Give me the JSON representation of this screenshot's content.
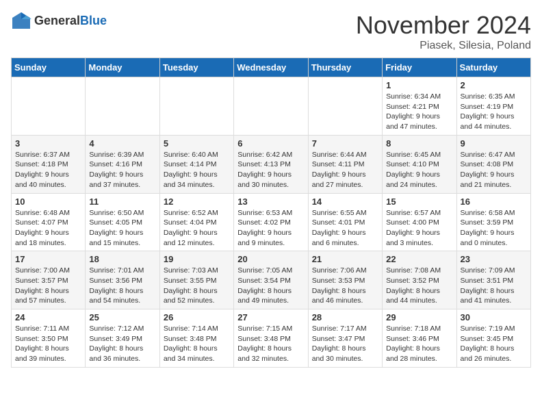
{
  "header": {
    "logo_general": "General",
    "logo_blue": "Blue",
    "month": "November 2024",
    "location": "Piasek, Silesia, Poland"
  },
  "days_of_week": [
    "Sunday",
    "Monday",
    "Tuesday",
    "Wednesday",
    "Thursday",
    "Friday",
    "Saturday"
  ],
  "weeks": [
    [
      {
        "day": "",
        "info": ""
      },
      {
        "day": "",
        "info": ""
      },
      {
        "day": "",
        "info": ""
      },
      {
        "day": "",
        "info": ""
      },
      {
        "day": "",
        "info": ""
      },
      {
        "day": "1",
        "info": "Sunrise: 6:34 AM\nSunset: 4:21 PM\nDaylight: 9 hours\nand 47 minutes."
      },
      {
        "day": "2",
        "info": "Sunrise: 6:35 AM\nSunset: 4:19 PM\nDaylight: 9 hours\nand 44 minutes."
      }
    ],
    [
      {
        "day": "3",
        "info": "Sunrise: 6:37 AM\nSunset: 4:18 PM\nDaylight: 9 hours\nand 40 minutes."
      },
      {
        "day": "4",
        "info": "Sunrise: 6:39 AM\nSunset: 4:16 PM\nDaylight: 9 hours\nand 37 minutes."
      },
      {
        "day": "5",
        "info": "Sunrise: 6:40 AM\nSunset: 4:14 PM\nDaylight: 9 hours\nand 34 minutes."
      },
      {
        "day": "6",
        "info": "Sunrise: 6:42 AM\nSunset: 4:13 PM\nDaylight: 9 hours\nand 30 minutes."
      },
      {
        "day": "7",
        "info": "Sunrise: 6:44 AM\nSunset: 4:11 PM\nDaylight: 9 hours\nand 27 minutes."
      },
      {
        "day": "8",
        "info": "Sunrise: 6:45 AM\nSunset: 4:10 PM\nDaylight: 9 hours\nand 24 minutes."
      },
      {
        "day": "9",
        "info": "Sunrise: 6:47 AM\nSunset: 4:08 PM\nDaylight: 9 hours\nand 21 minutes."
      }
    ],
    [
      {
        "day": "10",
        "info": "Sunrise: 6:48 AM\nSunset: 4:07 PM\nDaylight: 9 hours\nand 18 minutes."
      },
      {
        "day": "11",
        "info": "Sunrise: 6:50 AM\nSunset: 4:05 PM\nDaylight: 9 hours\nand 15 minutes."
      },
      {
        "day": "12",
        "info": "Sunrise: 6:52 AM\nSunset: 4:04 PM\nDaylight: 9 hours\nand 12 minutes."
      },
      {
        "day": "13",
        "info": "Sunrise: 6:53 AM\nSunset: 4:02 PM\nDaylight: 9 hours\nand 9 minutes."
      },
      {
        "day": "14",
        "info": "Sunrise: 6:55 AM\nSunset: 4:01 PM\nDaylight: 9 hours\nand 6 minutes."
      },
      {
        "day": "15",
        "info": "Sunrise: 6:57 AM\nSunset: 4:00 PM\nDaylight: 9 hours\nand 3 minutes."
      },
      {
        "day": "16",
        "info": "Sunrise: 6:58 AM\nSunset: 3:59 PM\nDaylight: 9 hours\nand 0 minutes."
      }
    ],
    [
      {
        "day": "17",
        "info": "Sunrise: 7:00 AM\nSunset: 3:57 PM\nDaylight: 8 hours\nand 57 minutes."
      },
      {
        "day": "18",
        "info": "Sunrise: 7:01 AM\nSunset: 3:56 PM\nDaylight: 8 hours\nand 54 minutes."
      },
      {
        "day": "19",
        "info": "Sunrise: 7:03 AM\nSunset: 3:55 PM\nDaylight: 8 hours\nand 52 minutes."
      },
      {
        "day": "20",
        "info": "Sunrise: 7:05 AM\nSunset: 3:54 PM\nDaylight: 8 hours\nand 49 minutes."
      },
      {
        "day": "21",
        "info": "Sunrise: 7:06 AM\nSunset: 3:53 PM\nDaylight: 8 hours\nand 46 minutes."
      },
      {
        "day": "22",
        "info": "Sunrise: 7:08 AM\nSunset: 3:52 PM\nDaylight: 8 hours\nand 44 minutes."
      },
      {
        "day": "23",
        "info": "Sunrise: 7:09 AM\nSunset: 3:51 PM\nDaylight: 8 hours\nand 41 minutes."
      }
    ],
    [
      {
        "day": "24",
        "info": "Sunrise: 7:11 AM\nSunset: 3:50 PM\nDaylight: 8 hours\nand 39 minutes."
      },
      {
        "day": "25",
        "info": "Sunrise: 7:12 AM\nSunset: 3:49 PM\nDaylight: 8 hours\nand 36 minutes."
      },
      {
        "day": "26",
        "info": "Sunrise: 7:14 AM\nSunset: 3:48 PM\nDaylight: 8 hours\nand 34 minutes."
      },
      {
        "day": "27",
        "info": "Sunrise: 7:15 AM\nSunset: 3:48 PM\nDaylight: 8 hours\nand 32 minutes."
      },
      {
        "day": "28",
        "info": "Sunrise: 7:17 AM\nSunset: 3:47 PM\nDaylight: 8 hours\nand 30 minutes."
      },
      {
        "day": "29",
        "info": "Sunrise: 7:18 AM\nSunset: 3:46 PM\nDaylight: 8 hours\nand 28 minutes."
      },
      {
        "day": "30",
        "info": "Sunrise: 7:19 AM\nSunset: 3:45 PM\nDaylight: 8 hours\nand 26 minutes."
      }
    ]
  ]
}
